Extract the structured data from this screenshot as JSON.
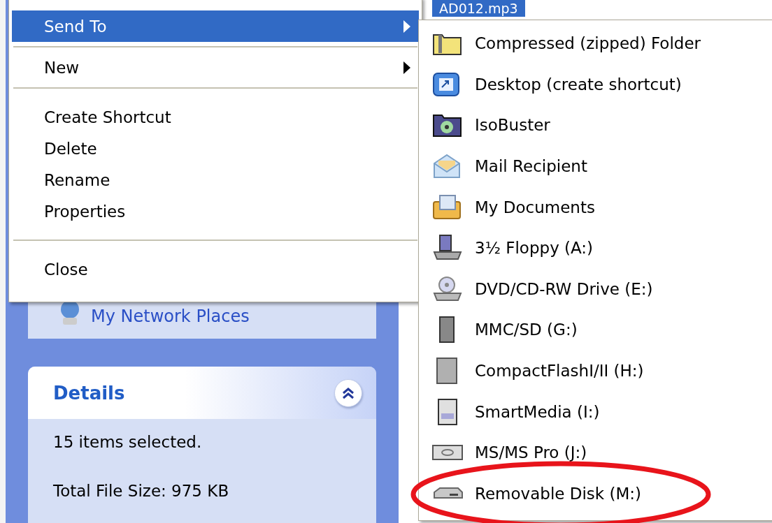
{
  "file_list": {
    "selected_file": "AD012.mp3"
  },
  "sidebar": {
    "places_link": "My Network Places",
    "details": {
      "title": "Details",
      "expanded": true,
      "lines": [
        "15 items selected.",
        "Total File Size: 975 KB"
      ]
    }
  },
  "context_menu": {
    "groups": [
      [
        {
          "label": "Send To",
          "selected": true,
          "submenu": true
        }
      ],
      [
        {
          "label": "New",
          "selected": false,
          "submenu": true
        }
      ],
      [
        {
          "label": "Create Shortcut",
          "selected": false,
          "submenu": false
        },
        {
          "label": "Delete",
          "selected": false,
          "submenu": false
        },
        {
          "label": "Rename",
          "selected": false,
          "submenu": false
        },
        {
          "label": "Properties",
          "selected": false,
          "submenu": false
        }
      ],
      [
        {
          "label": "Close",
          "selected": false,
          "submenu": false
        }
      ]
    ]
  },
  "send_to_menu": {
    "items": [
      {
        "label": "Compressed (zipped) Folder",
        "kind": "zip",
        "highlighted": false
      },
      {
        "label": "Desktop (create shortcut)",
        "kind": "desktop",
        "highlighted": false
      },
      {
        "label": "IsoBuster",
        "kind": "disc-folder",
        "highlighted": false
      },
      {
        "label": "Mail Recipient",
        "kind": "mail",
        "highlighted": false
      },
      {
        "label": "My Documents",
        "kind": "documents",
        "highlighted": false
      },
      {
        "label": "3½ Floppy (A:)",
        "kind": "floppy",
        "highlighted": false
      },
      {
        "label": "DVD/CD-RW Drive (E:)",
        "kind": "dvd",
        "highlighted": false
      },
      {
        "label": "MMC/SD (G:)",
        "kind": "card",
        "highlighted": false
      },
      {
        "label": "CompactFlashI/II (H:)",
        "kind": "cf",
        "highlighted": false
      },
      {
        "label": "SmartMedia (I:)",
        "kind": "smartmedia",
        "highlighted": false
      },
      {
        "label": "MS/MS Pro (J:)",
        "kind": "memorystick",
        "highlighted": false
      },
      {
        "label": "Removable Disk (M:)",
        "kind": "removable",
        "highlighted": true
      }
    ]
  }
}
